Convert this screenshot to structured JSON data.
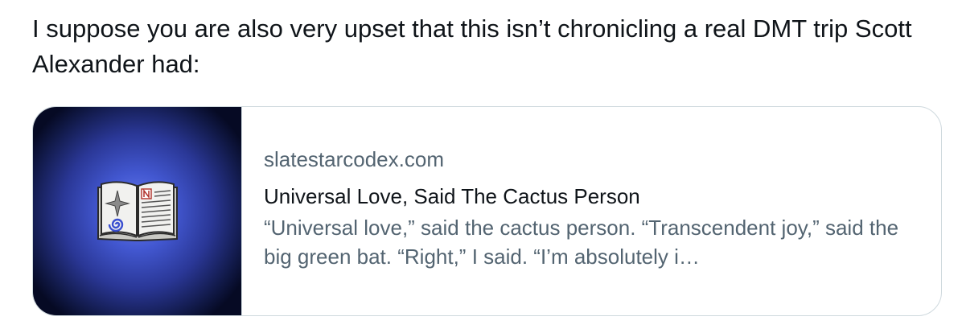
{
  "post": {
    "text": "I suppose you are also very upset that this isn’t chronicling a real DMT trip Scott Alexander had:"
  },
  "link_card": {
    "thumbnail_icon": "open-book-icon",
    "domain": "slatestarcodex.com",
    "title": "Universal Love, Said The Cactus Person",
    "description": "“Universal love,” said the cactus person. “Transcendent joy,” said the big green bat. “Right,” I said. “I’m absolutely i…"
  },
  "colors": {
    "text_primary": "#0f1419",
    "text_secondary": "#536471",
    "card_border": "#cfd9de",
    "thumb_glow": "#4257d0"
  }
}
